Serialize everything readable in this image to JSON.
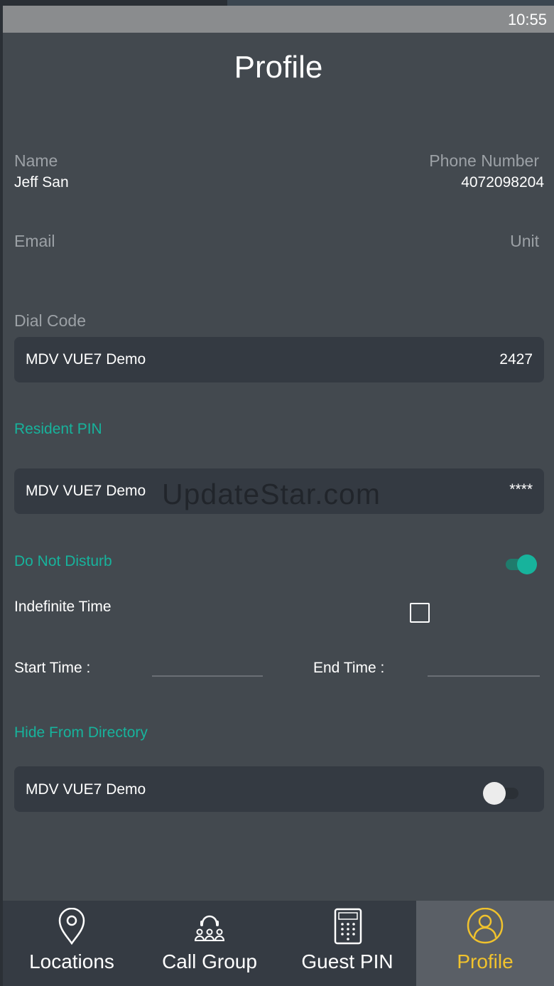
{
  "status_bar": {
    "time": "10:55"
  },
  "header": {
    "title": "Profile"
  },
  "profile": {
    "name_label": "Name",
    "name_value": "Jeff San",
    "phone_label": "Phone Number",
    "phone_value": "4072098204",
    "email_label": "Email",
    "unit_label": "Unit"
  },
  "dial_code": {
    "label": "Dial Code",
    "site": "MDV VUE7 Demo",
    "code": "2427"
  },
  "resident_pin": {
    "label": "Resident PIN",
    "site": "MDV VUE7 Demo",
    "pin_masked": "****"
  },
  "watermark": "UpdateStar.com",
  "do_not_disturb": {
    "label": "Do Not Disturb",
    "enabled": true,
    "indefinite_label": "Indefinite Time",
    "indefinite_checked": false,
    "start_label": "Start Time :",
    "start_value": "",
    "end_label": "End Time :",
    "end_value": ""
  },
  "hide_from_directory": {
    "label": "Hide From Directory",
    "site": "MDV VUE7 Demo",
    "enabled": false
  },
  "nav": {
    "items": [
      {
        "label": "Locations",
        "icon": "location-pin-icon"
      },
      {
        "label": "Call Group",
        "icon": "call-group-icon"
      },
      {
        "label": "Guest PIN",
        "icon": "keypad-icon"
      },
      {
        "label": "Profile",
        "icon": "user-icon"
      }
    ],
    "active_index": 3
  },
  "colors": {
    "background": "#43494f",
    "card": "#343a42",
    "accent": "#17b39c",
    "nav_active": "#f0c22d"
  }
}
